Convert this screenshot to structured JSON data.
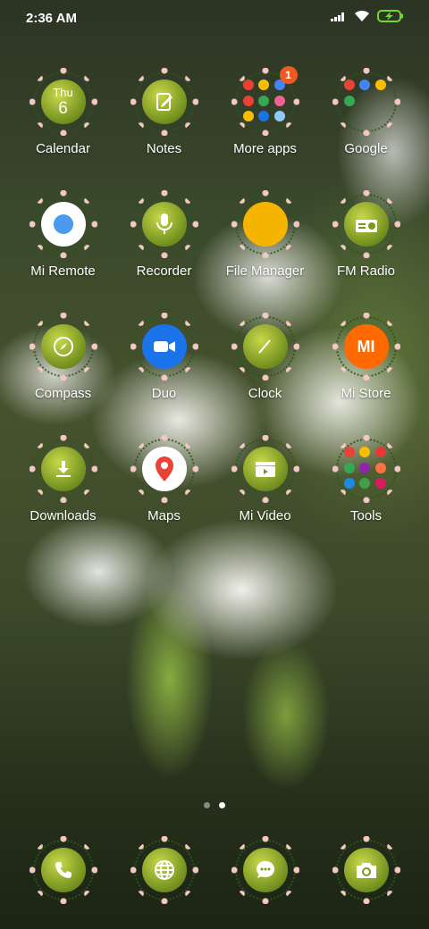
{
  "status": {
    "time": "2:36 AM"
  },
  "apps": [
    {
      "id": "calendar",
      "label": "Calendar",
      "day": "Thu",
      "date": "6"
    },
    {
      "id": "notes",
      "label": "Notes"
    },
    {
      "id": "more-apps",
      "label": "More apps",
      "badge": "1"
    },
    {
      "id": "google",
      "label": "Google"
    },
    {
      "id": "mi-remote",
      "label": "Mi Remote"
    },
    {
      "id": "recorder",
      "label": "Recorder"
    },
    {
      "id": "file-manager",
      "label": "File Manager"
    },
    {
      "id": "fm-radio",
      "label": "FM Radio"
    },
    {
      "id": "compass",
      "label": "Compass"
    },
    {
      "id": "duo",
      "label": "Duo"
    },
    {
      "id": "clock",
      "label": "Clock"
    },
    {
      "id": "mi-store",
      "label": "Mi Store",
      "logo": "MI"
    },
    {
      "id": "downloads",
      "label": "Downloads"
    },
    {
      "id": "maps",
      "label": "Maps"
    },
    {
      "id": "mi-video",
      "label": "Mi Video"
    },
    {
      "id": "tools",
      "label": "Tools"
    }
  ],
  "page_indicator": {
    "count": 2,
    "active": 2
  },
  "dock": [
    {
      "id": "phone",
      "icon": "phone-icon"
    },
    {
      "id": "browser",
      "icon": "globe-icon"
    },
    {
      "id": "messages",
      "icon": "message-icon"
    },
    {
      "id": "camera",
      "icon": "camera-icon"
    }
  ]
}
